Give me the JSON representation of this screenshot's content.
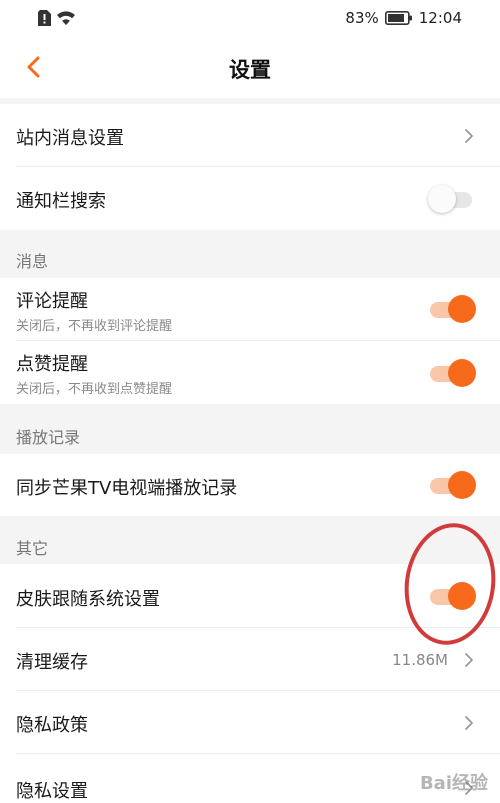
{
  "status_bar": {
    "battery_percent": "83%",
    "time": "12:04"
  },
  "header": {
    "title": "设置",
    "back_icon": "chevron-left-icon"
  },
  "rows": {
    "in_site_message": {
      "title": "站内消息设置"
    },
    "notification_search": {
      "title": "通知栏搜索",
      "toggle": false
    },
    "comment_reminder": {
      "title": "评论提醒",
      "subtitle": "关闭后，不再收到评论提醒",
      "toggle": true
    },
    "like_reminder": {
      "title": "点赞提醒",
      "subtitle": "关闭后，不再收到点赞提醒",
      "toggle": true
    },
    "sync_tv_history": {
      "title": "同步芒果TV电视端播放记录",
      "toggle": true
    },
    "skin_follow_system": {
      "title": "皮肤跟随系统设置",
      "toggle": true
    },
    "clear_cache": {
      "title": "清理缓存",
      "value": "11.86M"
    },
    "privacy_policy": {
      "title": "隐私政策"
    },
    "privacy_settings": {
      "title": "隐私设置"
    }
  },
  "sections": {
    "messages": "消息",
    "play_history": "播放记录",
    "others": "其它"
  },
  "colors": {
    "accent": "#f76a1c",
    "annotation": "#d23b3b"
  },
  "watermark": "Bai经验"
}
